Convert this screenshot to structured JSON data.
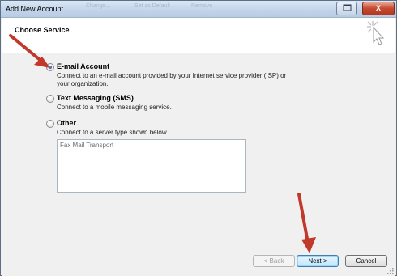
{
  "window": {
    "title": "Add New Account",
    "bg_title_texts": [
      "Change...",
      "Set as Default",
      "Remove"
    ],
    "controls": {
      "minimize": "–",
      "close": "X"
    }
  },
  "header": {
    "title": "Choose Service",
    "icon": "sparkle-cursor-icon"
  },
  "options": [
    {
      "label": "E-mail Account",
      "description": "Connect to an e-mail account provided by your Internet service provider (ISP) or your organization.",
      "selected": true
    },
    {
      "label": "Text Messaging (SMS)",
      "description": "Connect to a mobile messaging service.",
      "selected": false
    },
    {
      "label": "Other",
      "description": "Connect to a server type shown below.",
      "selected": false
    }
  ],
  "other_list": [
    "Fax Mail Transport"
  ],
  "buttons": {
    "back": "< Back",
    "next": "Next >",
    "cancel": "Cancel"
  },
  "annotation_color": "#c0392b"
}
